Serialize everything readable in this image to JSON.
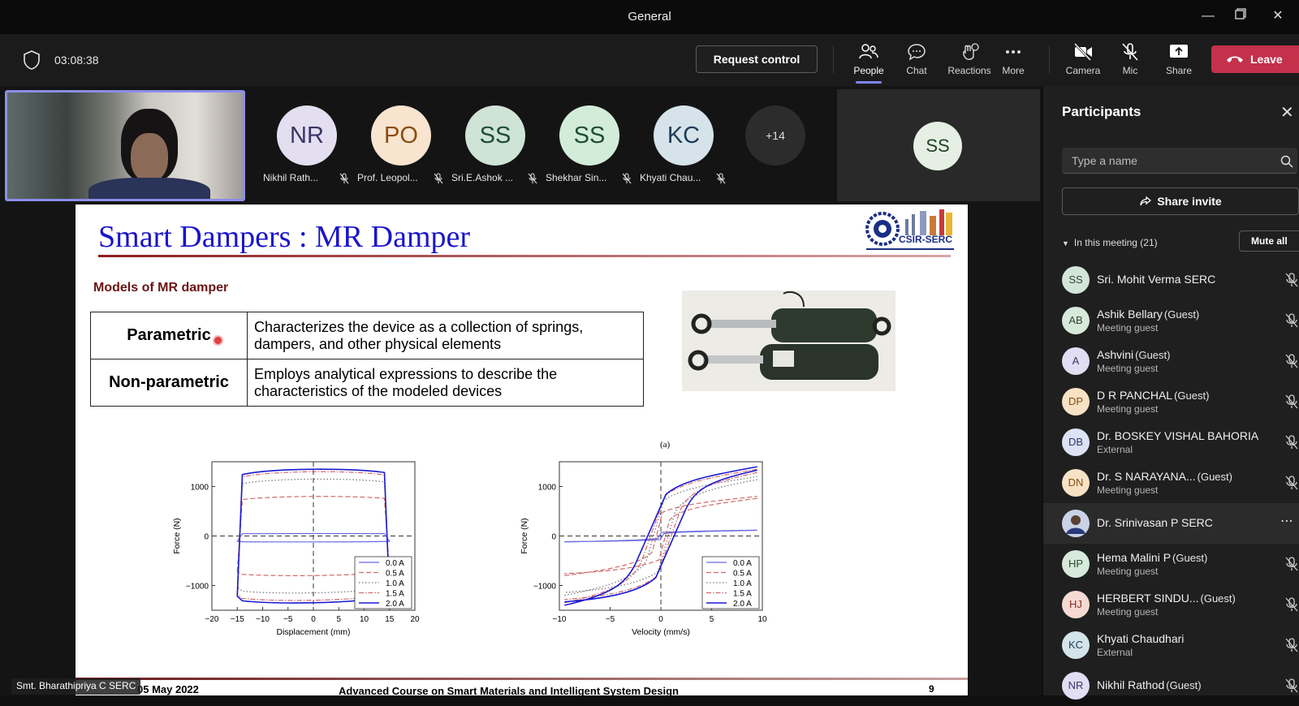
{
  "window": {
    "title": "General"
  },
  "toolbar": {
    "timer": "03:08:38",
    "request_control": "Request control",
    "items": {
      "people": "People",
      "chat": "Chat",
      "reactions": "Reactions",
      "more": "More",
      "camera": "Camera",
      "mic": "Mic",
      "share": "Share"
    },
    "leave": "Leave"
  },
  "video_strip": {
    "tiles": [
      {
        "initials": "NR",
        "name": "Nikhil Rath...",
        "bg": "#e3dff0",
        "fg": "#3b3566"
      },
      {
        "initials": "PO",
        "name": "Prof. Leopol...",
        "bg": "#f8e4cf",
        "fg": "#8a4d12"
      },
      {
        "initials": "SS",
        "name": "Sri.E.Ashok ...",
        "bg": "#cfe3d6",
        "fg": "#1f4d35"
      },
      {
        "initials": "SS",
        "name": "Shekhar Sin...",
        "bg": "#d3ecda",
        "fg": "#1f4d35"
      },
      {
        "initials": "KC",
        "name": "Khyati Chau...",
        "bg": "#d6e3ea",
        "fg": "#1f3d57"
      }
    ],
    "overflow": "+14",
    "large_tile_initials": "SS"
  },
  "slide": {
    "title": "Smart Dampers : MR Damper",
    "logo_text": "CSIR-SERC",
    "section_heading": "Models of MR damper",
    "rows": [
      {
        "key": "Parametric",
        "desc": "Characterizes the device as a collection of springs, dampers, and other physical elements"
      },
      {
        "key": "Non-parametric",
        "desc": "Employs analytical expressions to describe the characteristics of the modeled devices"
      }
    ],
    "figure_caption": "(a)",
    "footer_date": "05 May 2022",
    "footer_course": "Advanced Course on Smart Materials and Intelligent System Design",
    "page": "9"
  },
  "presenter_tag": "Smt. Bharathipriya C SERC",
  "chart_data": [
    {
      "type": "line",
      "xlabel": "Displacement (mm)",
      "ylabel": "Force (N)",
      "xlim": [
        -20,
        20
      ],
      "ylim": [
        -1500,
        1500
      ],
      "xticks": [
        "−20",
        "−15",
        "−10",
        "−5",
        "0",
        "5",
        "10",
        "15",
        "20"
      ],
      "yticks": [
        "1000",
        "0",
        "−1000"
      ],
      "legend": [
        "0.0 A",
        "0.5 A",
        "1.0 A",
        "1.5 A",
        "2.0 A"
      ],
      "legend_position": "bottom-right",
      "series": [
        {
          "name": "0.0 A",
          "upper": 50,
          "lower": -120
        },
        {
          "name": "0.5 A",
          "upper": 800,
          "lower": -800
        },
        {
          "name": "1.0 A",
          "upper": 1150,
          "lower": -1150
        },
        {
          "name": "1.5 A",
          "upper": 1300,
          "lower": -1300
        },
        {
          "name": "2.0 A",
          "upper": 1350,
          "lower": -1350
        }
      ]
    },
    {
      "type": "line",
      "xlabel": "Velocity (mm/s)",
      "ylabel": "Force (N)",
      "xlim": [
        -10,
        10
      ],
      "ylim": [
        -1500,
        1500
      ],
      "xticks": [
        "−10",
        "−5",
        "0",
        "5",
        "10"
      ],
      "yticks": [
        "1000",
        "0",
        "−1000"
      ],
      "legend": [
        "0.0 A",
        "0.5 A",
        "1.0 A",
        "1.5 A",
        "2.0 A"
      ],
      "legend_position": "bottom-right",
      "series": [
        {
          "name": "0.0 A",
          "max": 120
        },
        {
          "name": "0.5 A",
          "max": 800
        },
        {
          "name": "1.0 A",
          "max": 1200
        },
        {
          "name": "1.5 A",
          "max": 1350
        },
        {
          "name": "2.0 A",
          "max": 1400
        }
      ]
    }
  ],
  "participants": {
    "title": "Participants",
    "search_placeholder": "Type a name",
    "share_invite": "Share invite",
    "in_meeting": "In this meeting (21)",
    "mute_all": "Mute all",
    "list": [
      {
        "initials": "SS",
        "name": "Sri. Mohit Verma SERC",
        "tag": "",
        "sub": "",
        "bg": "#d3e4d8",
        "fg": "#2b4a36"
      },
      {
        "initials": "AB",
        "name": "Ashik Bellary",
        "tag": "(Guest)",
        "sub": "Meeting guest",
        "bg": "#d6e9da",
        "fg": "#2b4a36"
      },
      {
        "initials": "A",
        "name": "Ashvini",
        "tag": "(Guest)",
        "sub": "Meeting guest",
        "bg": "#e1ddf3",
        "fg": "#3b3566"
      },
      {
        "initials": "DP",
        "name": "D R PANCHAL",
        "tag": "(Guest)",
        "sub": "Meeting guest",
        "bg": "#f7e2c5",
        "fg": "#8a4d12"
      },
      {
        "initials": "DB",
        "name": "Dr. BOSKEY VISHAL BAHORIA",
        "tag": "",
        "sub": "External",
        "bg": "#dde2f4",
        "fg": "#2f3a6b"
      },
      {
        "initials": "DN",
        "name": "Dr. S NARAYANA...",
        "tag": "(Guest)",
        "sub": "Meeting guest",
        "bg": "#f7e2c5",
        "fg": "#8a4d12"
      },
      {
        "initials": "",
        "name": "Dr. Srinivasan P SERC",
        "tag": "",
        "sub": "",
        "bg": "#7b8aa8",
        "fg": "#fff"
      },
      {
        "initials": "HP",
        "name": "Hema Malini P",
        "tag": "(Guest)",
        "sub": "Meeting guest",
        "bg": "#d6e9da",
        "fg": "#2b4a36"
      },
      {
        "initials": "HJ",
        "name": "HERBERT SINDU...",
        "tag": "(Guest)",
        "sub": "Meeting guest",
        "bg": "#f6d9d2",
        "fg": "#8a2f1e"
      },
      {
        "initials": "KC",
        "name": "Khyati Chaudhari",
        "tag": "",
        "sub": "External",
        "bg": "#d3e4ea",
        "fg": "#1f3d57"
      },
      {
        "initials": "NR",
        "name": "Nikhil Rathod",
        "tag": "(Guest)",
        "sub": "",
        "bg": "#e1ddf3",
        "fg": "#3b3566"
      }
    ]
  },
  "colors": {
    "accent": "#7f85f5",
    "leave": "#c4314b",
    "slide_title": "#1a15c9",
    "section_heading": "#6b1414"
  }
}
